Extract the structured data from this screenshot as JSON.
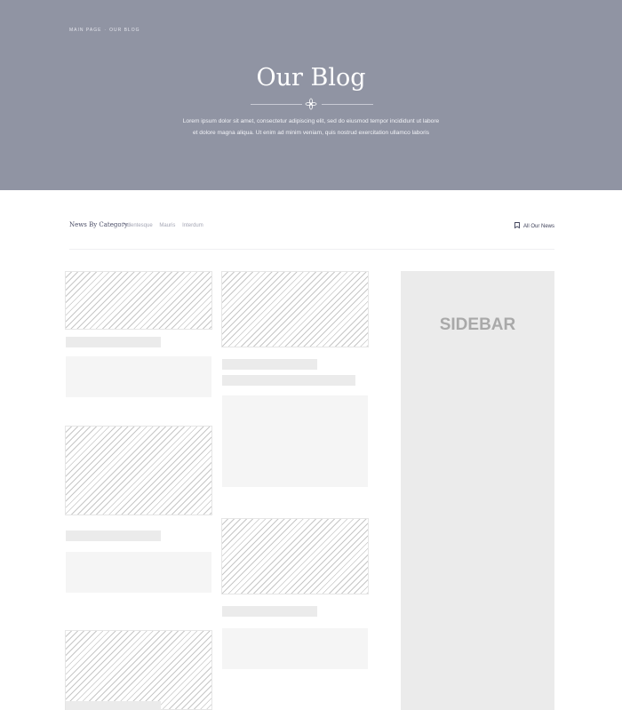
{
  "hero": {
    "breadcrumb": {
      "home": "MAIN PAGE",
      "separator": "·",
      "current": "OUR BLOG"
    },
    "title": "Our Blog",
    "intro_line1": "Lorem ipsum dolor sit amet, consectetur adipiscing elit, sed do eiusmod tempor incididunt ut labore",
    "intro_line2": "et dolore magna aliqua. Ut enim ad minim veniam, quis nostrud exercitation ullamco laboris",
    "background": "#9094a3"
  },
  "filter": {
    "label": "News By Category:",
    "categories": [
      "Pellentesque",
      "Mauris",
      "Interdum"
    ],
    "all_news": "All Our News",
    "all_news_icon": "bookmark-icon"
  },
  "sidebar": {
    "label": "SIDEBAR"
  }
}
